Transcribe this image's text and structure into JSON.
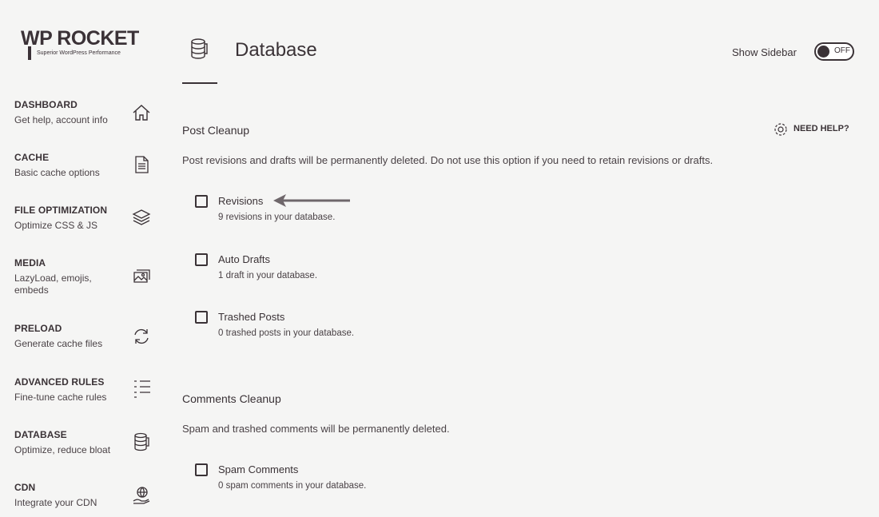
{
  "brand": {
    "name": "WP ROCKET",
    "tagline": "Superior WordPress Performance"
  },
  "sidebar": {
    "items": [
      {
        "title": "DASHBOARD",
        "desc": "Get help, account info",
        "icon": "home-icon"
      },
      {
        "title": "CACHE",
        "desc": "Basic cache options",
        "icon": "document-icon"
      },
      {
        "title": "FILE OPTIMIZATION",
        "desc": "Optimize CSS & JS",
        "icon": "layers-icon"
      },
      {
        "title": "MEDIA",
        "desc": "LazyLoad, emojis, embeds",
        "icon": "image-icon"
      },
      {
        "title": "PRELOAD",
        "desc": "Generate cache files",
        "icon": "refresh-icon"
      },
      {
        "title": "ADVANCED RULES",
        "desc": "Fine-tune cache rules",
        "icon": "list-icon"
      },
      {
        "title": "DATABASE",
        "desc": "Optimize, reduce bloat",
        "icon": "database-icon"
      },
      {
        "title": "CDN",
        "desc": "Integrate your CDN",
        "icon": "globe-hand-icon"
      }
    ]
  },
  "header": {
    "title": "Database",
    "icon": "database-icon",
    "show_sidebar_label": "Show Sidebar",
    "toggle_state": "OFF"
  },
  "post_cleanup": {
    "title": "Post Cleanup",
    "help_label": "NEED HELP?",
    "description": "Post revisions and drafts will be permanently deleted. Do not use this option if you need to retain revisions or drafts.",
    "options": [
      {
        "label": "Revisions",
        "desc": "9 revisions in your database.",
        "checked": false
      },
      {
        "label": "Auto Drafts",
        "desc": "1 draft in your database.",
        "checked": false
      },
      {
        "label": "Trashed Posts",
        "desc": "0 trashed posts in your database.",
        "checked": false
      }
    ]
  },
  "comments_cleanup": {
    "title": "Comments Cleanup",
    "description": "Spam and trashed comments will be permanently deleted.",
    "options": [
      {
        "label": "Spam Comments",
        "desc": "0 spam comments in your database.",
        "checked": false
      }
    ]
  },
  "colors": {
    "text": "#3a3236",
    "background": "#f5f5f4"
  }
}
